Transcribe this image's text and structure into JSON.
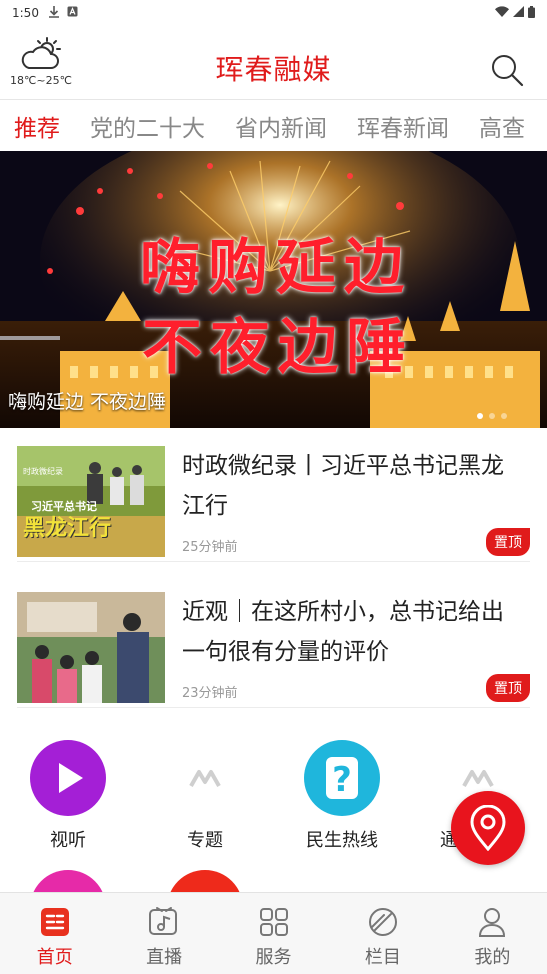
{
  "status_bar": {
    "time": "1:50",
    "download_icon": "download-icon",
    "a_icon": "a-badge-icon"
  },
  "header": {
    "weather_icon": "cloud-sun-icon",
    "temperature": "18℃~25℃",
    "title": "珲春融媒",
    "search_icon": "search-icon"
  },
  "tabs": [
    {
      "label": "推荐",
      "active": true
    },
    {
      "label": "党的二十大",
      "active": false
    },
    {
      "label": "省内新闻",
      "active": false
    },
    {
      "label": "珲春新闻",
      "active": false
    },
    {
      "label": "高查",
      "active": false
    }
  ],
  "banner": {
    "overlay_line1": "嗨购延边",
    "overlay_line2": "不夜边陲",
    "caption": "嗨购延边 不夜边陲"
  },
  "news": [
    {
      "title": "时政微纪录丨习近平总书记黑龙江行",
      "time": "25分钟前",
      "badge": "置顶",
      "thumb_text_1": "习近平总书记",
      "thumb_text_2": "黑龙江行",
      "thumb_text_small": "时政微纪录"
    },
    {
      "title": "近观｜在这所村小，总书记给出一句很有分量的评价",
      "time": "23分钟前",
      "badge": "置顶"
    }
  ],
  "quick_services": [
    {
      "label": "视听",
      "icon": "play-icon",
      "color": "#a41fd6"
    },
    {
      "label": "专题",
      "icon": "topic-logo-icon",
      "color": "#cfcfcf"
    },
    {
      "label": "民生热线",
      "icon": "question-icon",
      "color": "#1fb6dc"
    },
    {
      "label": "通",
      "icon": "topic-logo-icon",
      "color": "#cfcfcf"
    }
  ],
  "partial_row_colors": [
    "#e62aa8",
    "#ee2a1b"
  ],
  "location_fab": {
    "icon": "location-pin-icon",
    "color": "#e8141d"
  },
  "bottom_nav": [
    {
      "label": "首页",
      "icon": "home-news-icon",
      "active": true
    },
    {
      "label": "直播",
      "icon": "live-music-icon",
      "active": false
    },
    {
      "label": "服务",
      "icon": "services-grid-icon",
      "active": false
    },
    {
      "label": "栏目",
      "icon": "columns-planet-icon",
      "active": false
    },
    {
      "label": "我的",
      "icon": "user-icon",
      "active": false
    }
  ],
  "colors": {
    "brand_red": "#e01b1b",
    "inactive_text": "#888888"
  }
}
